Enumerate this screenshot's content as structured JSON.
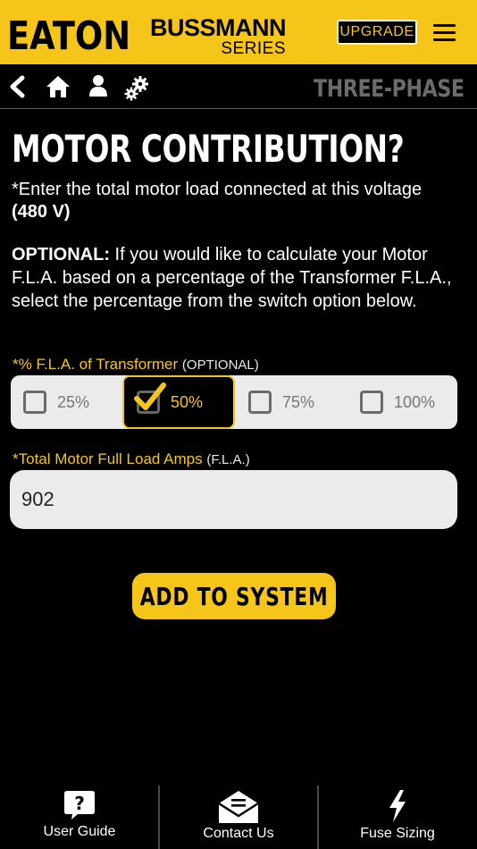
{
  "header": {
    "brand": "EATON",
    "series_line1": "BUSSMANN",
    "series_line2": "SERIES",
    "upgrade_label": "UPGRADE",
    "accent_color": "#f5c51a"
  },
  "nav": {
    "icons": [
      "back-icon",
      "home-icon",
      "user-icon",
      "gear-icon"
    ],
    "section": "THREE-PHASE"
  },
  "main": {
    "title": "MOTOR CONTRIBUTION?",
    "instruction": "*Enter the total motor load connected at this voltage",
    "voltage": "(480 V)",
    "optional_label": "OPTIONAL:",
    "optional_text": " If you would like to calculate your Motor F.L.A. based on a percentage of the Transformer F.L.A., select the percentage from the switch option below.",
    "percent_field": {
      "label": "*% F.L.A. of Transformer",
      "label_note": "(OPTIONAL)",
      "options": [
        "25%",
        "50%",
        "75%",
        "100%"
      ],
      "selected": "50%"
    },
    "fla_field": {
      "label": "*Total Motor Full Load Amps",
      "label_note": "(F.L.A.)",
      "value": "902"
    },
    "add_button": "ADD TO SYSTEM"
  },
  "footer": {
    "items": [
      {
        "label": "User Guide",
        "icon": "question-icon"
      },
      {
        "label": "Contact Us",
        "icon": "envelope-icon"
      },
      {
        "label": "Fuse Sizing",
        "icon": "lightning-icon"
      }
    ]
  }
}
